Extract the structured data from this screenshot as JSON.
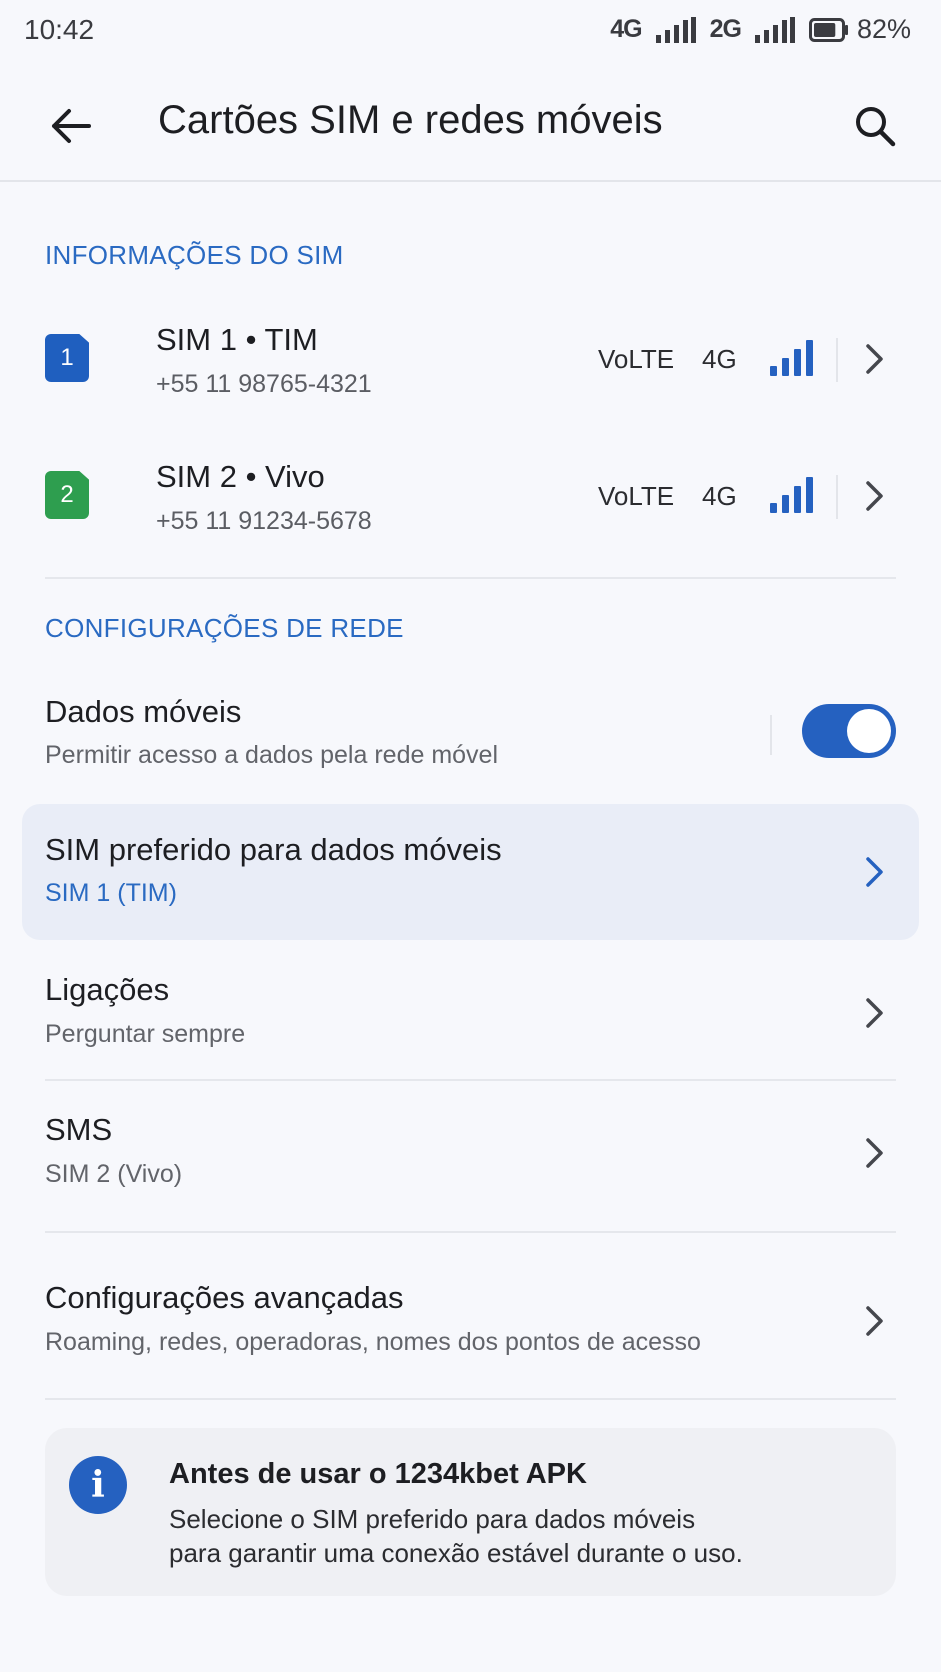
{
  "status_bar": {
    "time": "10:42",
    "net1": "4G",
    "net2": "2G",
    "battery": "82%",
    "battery_level": 0.82
  },
  "app_bar": {
    "title": "Cartões SIM e redes móveis",
    "back_icon": "arrow-left-icon",
    "search_icon": "search-icon"
  },
  "sim_section": {
    "label": "INFORMAÇÕES DO SIM",
    "sims": [
      {
        "badge": "1",
        "name": "SIM 1 • TIM",
        "number": "+55 11 98765-4321",
        "volte": "VoLTE",
        "network": "4G",
        "color": "#1f5fbf"
      },
      {
        "badge": "2",
        "name": "SIM 2 • Vivo",
        "number": "+55 11 91234-5678",
        "volte": "VoLTE",
        "network": "4G",
        "color": "#2e9e4f"
      }
    ]
  },
  "network_section": {
    "label": "CONFIGURAÇÕES DE REDE",
    "mobile_data": {
      "title": "Dados móveis",
      "subtitle": "Permitir acesso a dados pela rede móvel",
      "enabled": true
    },
    "items": [
      {
        "title": "SIM preferido para dados móveis",
        "subtitle": "SIM 1 (TIM)"
      },
      {
        "title": "Ligações",
        "subtitle": "Perguntar sempre"
      },
      {
        "title": "SMS",
        "subtitle": "SIM 2 (Vivo)"
      },
      {
        "title": "Configurações avançadas",
        "subtitle": "Roaming, redes, operadoras, nomes dos pontos de acesso"
      }
    ]
  },
  "info_card": {
    "icon": "info-icon",
    "title": "Antes de usar o 1234kbet APK",
    "line1": "Selecione o SIM preferido para dados móveis",
    "line2": "para garantir uma conexão estável durante o uso."
  },
  "colors": {
    "accent": "#2a6ac2",
    "toggle_on": "#2561c0",
    "highlight": "#e9edf7"
  }
}
